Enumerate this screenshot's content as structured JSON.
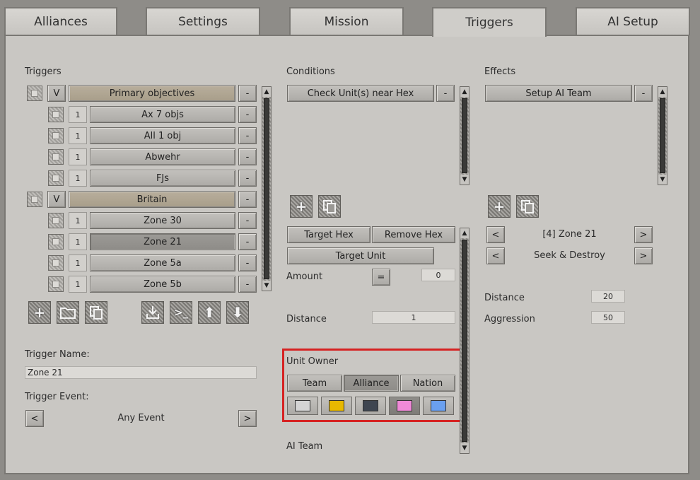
{
  "tabs": [
    "Alliances",
    "Settings",
    "Mission",
    "Triggers",
    "AI Setup"
  ],
  "triggers": {
    "heading": "Triggers",
    "rows": [
      {
        "kind": "group",
        "flag": "V",
        "label": "Primary objectives"
      },
      {
        "kind": "item",
        "count": "1",
        "label": "Ax 7 objs"
      },
      {
        "kind": "item",
        "count": "1",
        "label": "All 1 obj"
      },
      {
        "kind": "item",
        "count": "1",
        "label": "Abwehr"
      },
      {
        "kind": "item",
        "count": "1",
        "label": "FJs"
      },
      {
        "kind": "group",
        "flag": "V",
        "label": "Britain"
      },
      {
        "kind": "item",
        "count": "1",
        "label": "Zone 30"
      },
      {
        "kind": "item",
        "count": "1",
        "label": "Zone 21",
        "selected": true
      },
      {
        "kind": "item",
        "count": "1",
        "label": "Zone 5a"
      },
      {
        "kind": "item",
        "count": "1",
        "label": "Zone 5b"
      }
    ],
    "remove_label": "-",
    "name_label": "Trigger Name:",
    "name_value": "Zone 21",
    "event_label": "Trigger Event:",
    "event_value": "Any Event",
    "prev": "<",
    "next": ">"
  },
  "conditions": {
    "heading": "Conditions",
    "item": "Check Unit(s) near Hex",
    "remove_label": "-",
    "target_hex": "Target Hex",
    "remove_hex": "Remove Hex",
    "target_unit": "Target Unit",
    "amount_label": "Amount",
    "amount_op": "=",
    "amount_value": "0",
    "distance_label": "Distance",
    "distance_value": "1",
    "unit_owner_label": "Unit Owner",
    "owner_options": [
      "Team",
      "Alliance",
      "Nation"
    ],
    "owner_selected": "Alliance",
    "colors": [
      "#d4d4d4",
      "#e8b800",
      "#3e4550",
      "#f08ad8",
      "#6aa0f0"
    ],
    "selected_color_index": 3,
    "ai_team_label": "AI Team"
  },
  "effects": {
    "heading": "Effects",
    "item": "Setup AI Team",
    "remove_label": "-",
    "zone_value": "[4] Zone 21",
    "mode_value": "Seek & Destroy",
    "prev": "<",
    "next": ">",
    "distance_label": "Distance",
    "distance_value": "20",
    "aggression_label": "Aggression",
    "aggression_value": "50"
  },
  "icons": {
    "add": "plus-icon",
    "copy": "copy-icon",
    "folder": "folder-icon",
    "import": "import-icon",
    "console": "console-icon",
    "up": "arrow-up-icon",
    "down": "arrow-down-icon"
  }
}
